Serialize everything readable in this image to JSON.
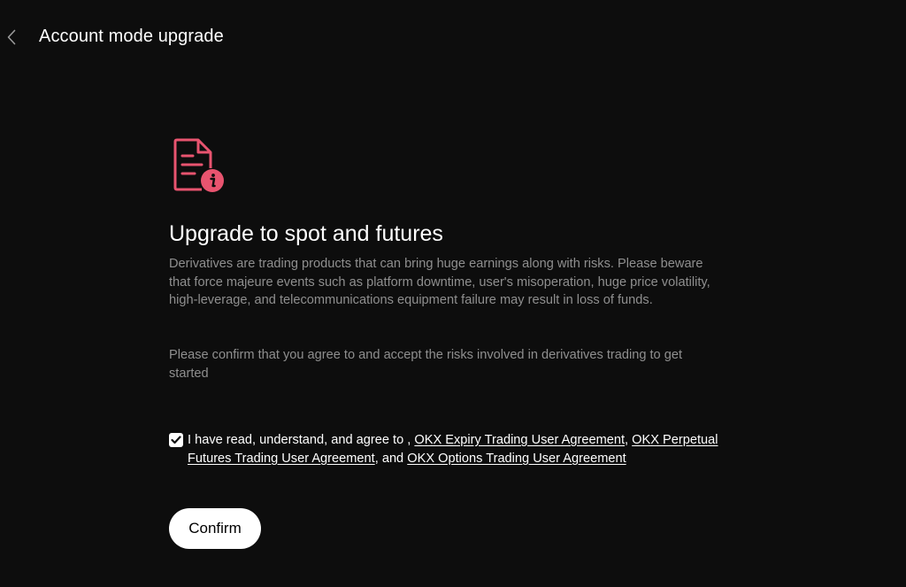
{
  "header": {
    "back_icon": "chevron-left-icon",
    "title": "Account mode upgrade"
  },
  "main": {
    "icon": "document-info-icon",
    "icon_color": "#e8546f",
    "heading": "Upgrade to spot and futures",
    "description": "Derivatives are trading products that can bring huge earnings along with risks. Please beware that force majeure events such as platform downtime, user's misoperation, huge price volatility, high-leverage, and telecommunications equipment failure may result in loss of funds.",
    "confirm_prompt": "Please confirm that you agree to and accept the risks involved in derivatives trading to get started",
    "agreement": {
      "checked": true,
      "prefix": "I have read, understand, and agree to ,",
      "link1": "OKX Expiry Trading User Agreement",
      "sep1": ",",
      "link2": "OKX Perpetual Futures Trading User Agreement",
      "sep2": ", and",
      "link3": "OKX Options Trading User Agreement"
    },
    "confirm_label": "Confirm"
  },
  "colors": {
    "background": "#0d0d0d",
    "text_primary": "#ffffff",
    "text_secondary": "#8f8f8f",
    "accent": "#e8546f"
  }
}
